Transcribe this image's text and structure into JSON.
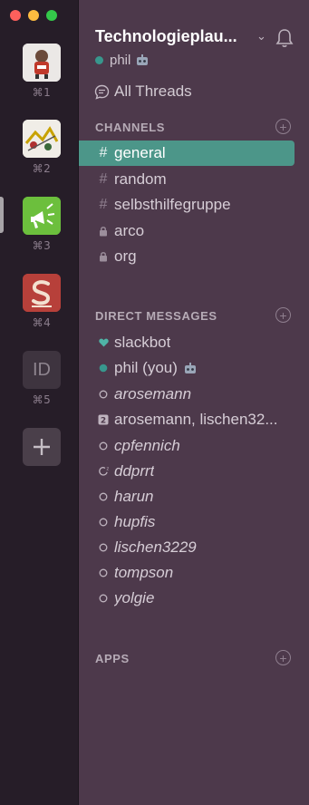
{
  "window": {
    "controls": [
      "close",
      "minimize",
      "zoom"
    ]
  },
  "teams": [
    {
      "shortcut": "⌘1",
      "avatar": "team-1-avatar"
    },
    {
      "shortcut": "⌘2",
      "avatar": "team-2-avatar"
    },
    {
      "shortcut": "⌘3",
      "avatar": "megaphone-avatar",
      "active": true
    },
    {
      "shortcut": "⌘4",
      "avatar": "s-logo-avatar"
    },
    {
      "shortcut": "⌘5",
      "initials": "ID"
    }
  ],
  "header": {
    "team_name": "Technologieplau...",
    "user": "phil"
  },
  "all_threads": "All Threads",
  "channels": {
    "heading": "CHANNELS",
    "items": [
      {
        "prefix": "#",
        "name": "general",
        "selected": true
      },
      {
        "prefix": "#",
        "name": "random"
      },
      {
        "prefix": "#",
        "name": "selbsthilfegruppe"
      },
      {
        "prefix": "lock",
        "name": "arco"
      },
      {
        "prefix": "lock",
        "name": "org"
      }
    ]
  },
  "direct_messages": {
    "heading": "DIRECT MESSAGES",
    "items": [
      {
        "icon": "heart",
        "name": "slackbot"
      },
      {
        "icon": "online",
        "name": "phil (you)"
      },
      {
        "icon": "offline",
        "name": "arosemann"
      },
      {
        "icon": "group-2",
        "name": "arosemann, lischen32..."
      },
      {
        "icon": "offline",
        "name": "cpfennich"
      },
      {
        "icon": "away",
        "name": "ddprrt"
      },
      {
        "icon": "offline",
        "name": "harun"
      },
      {
        "icon": "offline",
        "name": "hupfis"
      },
      {
        "icon": "offline",
        "name": "lischen3229"
      },
      {
        "icon": "offline",
        "name": "tompson"
      },
      {
        "icon": "offline",
        "name": "yolgie"
      }
    ]
  },
  "apps": {
    "heading": "APPS"
  },
  "colors": {
    "sidebar": "#4d394b",
    "rail": "#261d28",
    "selected": "#4c9689",
    "presence": "#38978d"
  }
}
